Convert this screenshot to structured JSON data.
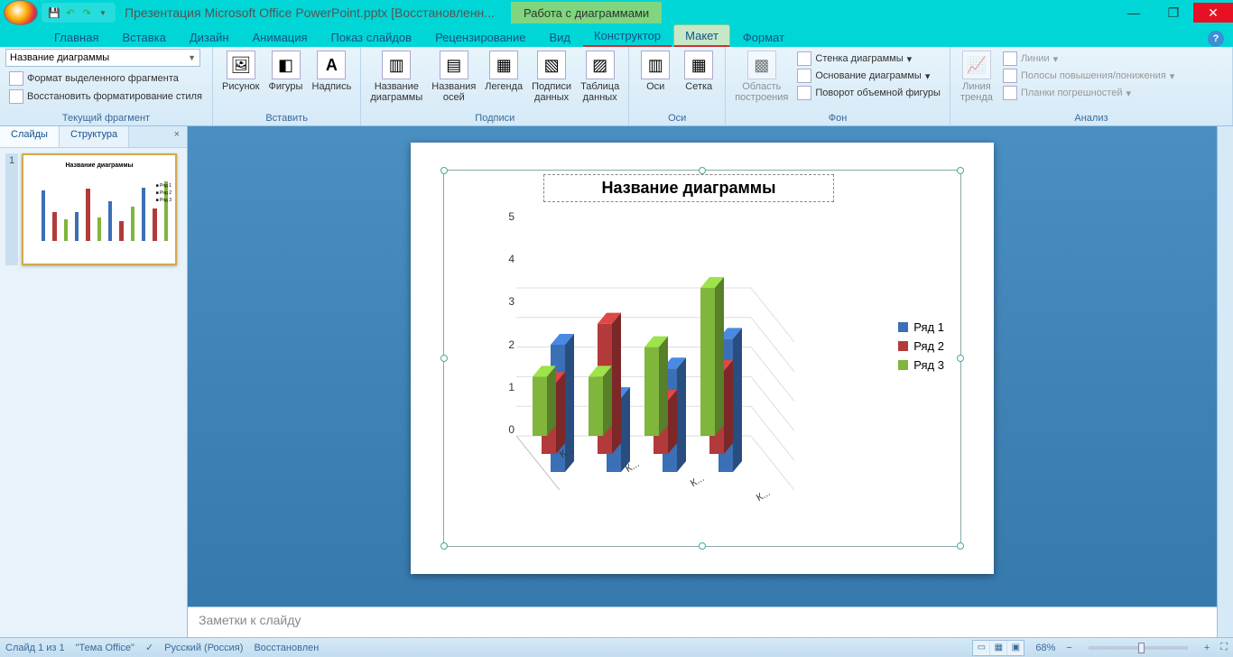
{
  "title": "Презентация Microsoft Office PowerPoint.pptx [Восстановленн...",
  "context_tab": "Работа с диаграммами",
  "tabs": [
    "Главная",
    "Вставка",
    "Дизайн",
    "Анимация",
    "Показ слайдов",
    "Рецензирование",
    "Вид",
    "Конструктор",
    "Макет",
    "Формат"
  ],
  "active_tab": "Макет",
  "help_tooltip": "?",
  "ribbon": {
    "g1": {
      "label": "Текущий фрагмент",
      "selector": "Название диаграммы",
      "btn1": "Формат выделенного фрагмента",
      "btn2": "Восстановить форматирование стиля"
    },
    "g2": {
      "label": "Вставить",
      "b1": "Рисунок",
      "b2": "Фигуры",
      "b3": "Надпись"
    },
    "g3": {
      "label": "Подписи",
      "b1": "Название\nдиаграммы",
      "b2": "Названия\nосей",
      "b3": "Легенда",
      "b4": "Подписи\nданных",
      "b5": "Таблица\nданных"
    },
    "g4": {
      "label": "Оси",
      "b1": "Оси",
      "b2": "Сетка"
    },
    "g5": {
      "label": "Фон",
      "b1": "Область\nпостроения",
      "s1": "Стенка диаграммы",
      "s2": "Основание диаграммы",
      "s3": "Поворот объемной фигуры"
    },
    "g6": {
      "label": "Анализ",
      "b1": "Линия\nтренда",
      "s1": "Линии",
      "s2": "Полосы повышения/понижения",
      "s3": "Планки погрешностей"
    }
  },
  "slidepanel": {
    "tab1": "Слайды",
    "tab2": "Структура",
    "num": "1"
  },
  "chart_title": "Название диаграммы",
  "notes_placeholder": "Заметки к слайду",
  "status": {
    "slide": "Слайд 1 из 1",
    "theme": "\"Тема Office\"",
    "lang": "Русский (Россия)",
    "recov": "Восстановлен",
    "zoom": "68%"
  },
  "chart_data": {
    "type": "bar",
    "title": "Название диаграммы",
    "ylim": [
      0,
      5
    ],
    "yticks": [
      0,
      1,
      2,
      3,
      4,
      5
    ],
    "categories": [
      "К...",
      "К...",
      "К...",
      "К..."
    ],
    "series": [
      {
        "name": "Ряд 1",
        "color": "#3b6fb6",
        "values": [
          4.3,
          2.5,
          3.5,
          4.5
        ]
      },
      {
        "name": "Ряд 2",
        "color": "#b23a3a",
        "values": [
          2.4,
          4.4,
          1.8,
          2.8
        ]
      },
      {
        "name": "Ряд 3",
        "color": "#7fb63b",
        "values": [
          2.0,
          2.0,
          3.0,
          5.0
        ]
      }
    ]
  },
  "legend_items": [
    {
      "label": "Ряд 1",
      "color": "#3b6fb6"
    },
    {
      "label": "Ряд 2",
      "color": "#b23a3a"
    },
    {
      "label": "Ряд 3",
      "color": "#7fb63b"
    }
  ]
}
